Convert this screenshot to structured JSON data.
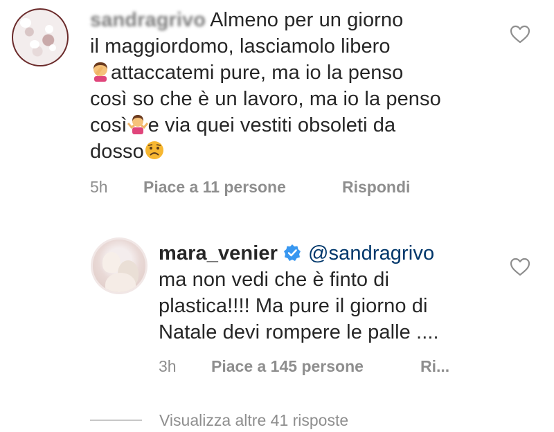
{
  "comments": [
    {
      "username": "sandragrivo",
      "text_lines": [
        "Almeno per un giorno",
        "il maggiordomo, lasciamolo libero",
        "attaccatemi pure, ma io la penso",
        "così so che è un lavoro, ma io la penso",
        "così",
        "e via quei vestiti obsoleti da",
        "dosso"
      ],
      "emojis": [
        "facepalm-emoji",
        "shrug-emoji",
        "worried-face-emoji"
      ],
      "time": "5h",
      "likes": "Piace a 11 persone",
      "reply": "Rispondi"
    },
    {
      "username": "mara_venier",
      "verified": true,
      "mention": "@sandragrivo",
      "text_lines": [
        "ma non vedi che è finto di",
        "plastica!!!! Ma pure il giorno di",
        "Natale devi rompere le palle ...."
      ],
      "time": "3h",
      "likes": "Piace a 145 persone",
      "reply": "Ri..."
    }
  ],
  "view_replies": "Visualizza altre 41 risposte",
  "colors": {
    "text": "#262626",
    "meta": "#8e8e8e",
    "mention": "#00376b",
    "verified": "#3897f0"
  },
  "icons": [
    "heart-icon",
    "verified-icon"
  ]
}
